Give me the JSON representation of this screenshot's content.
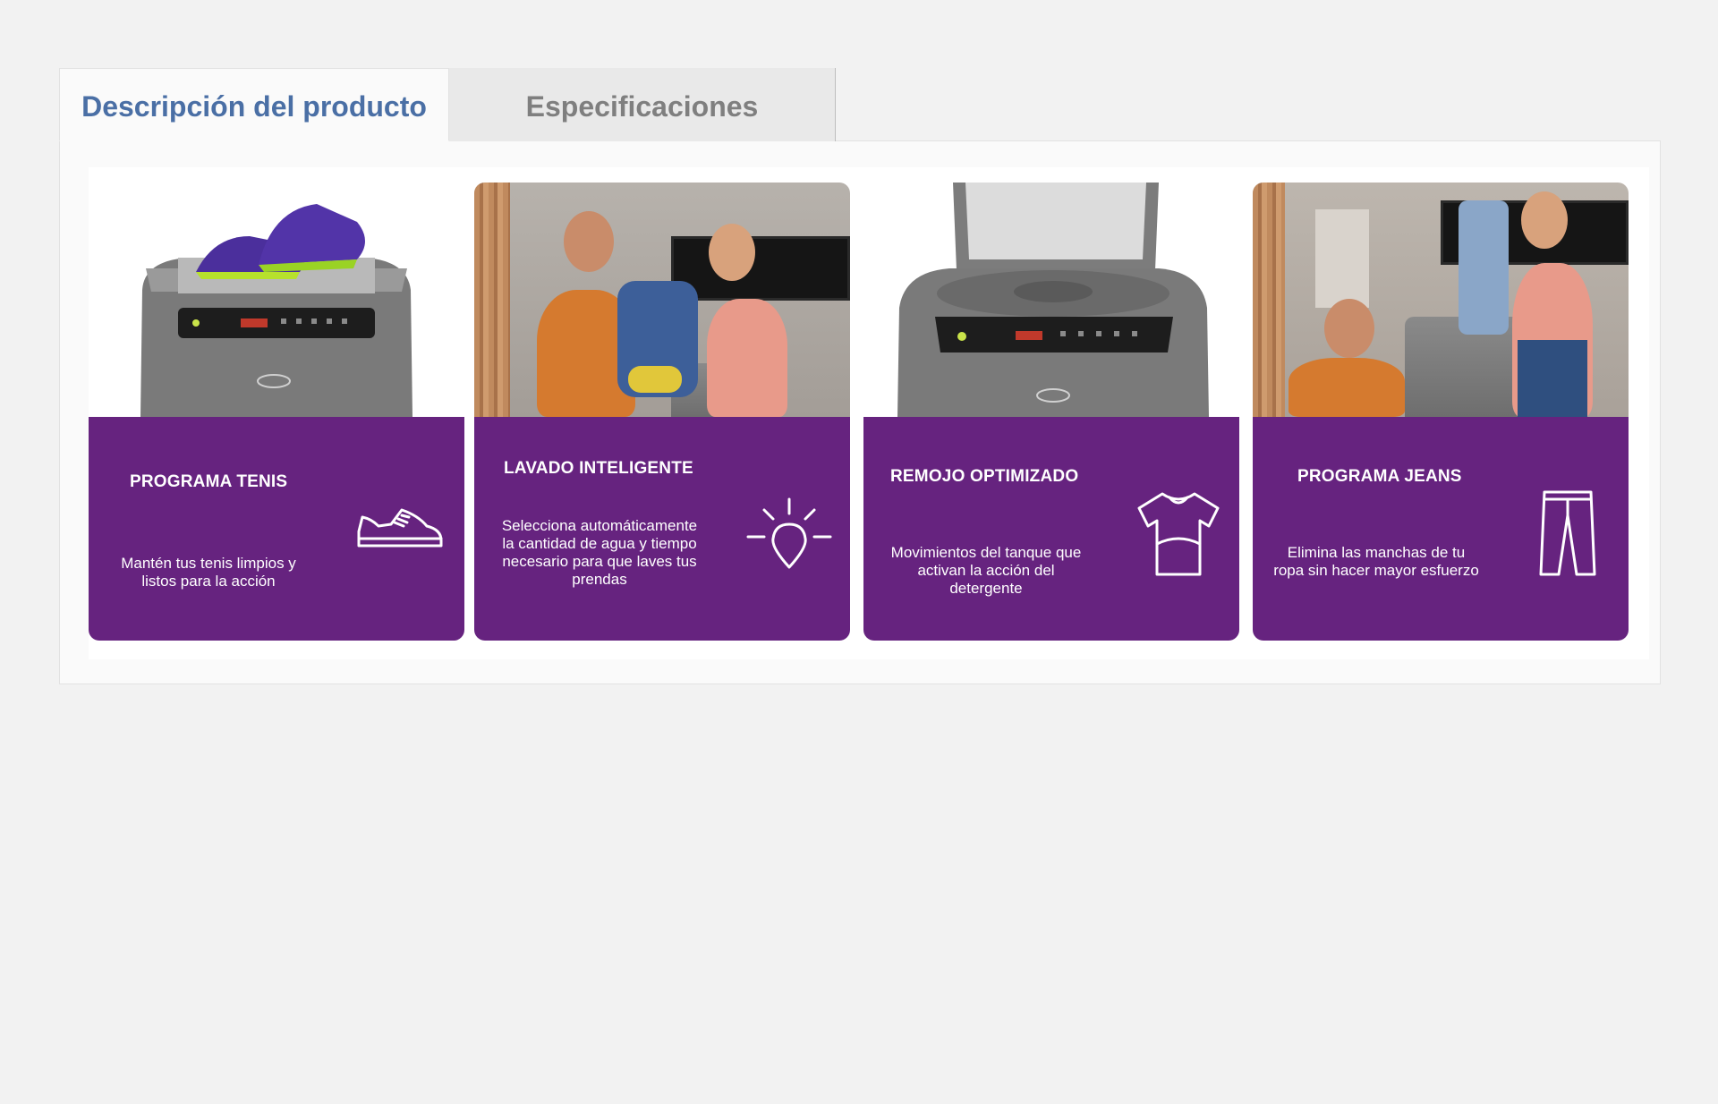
{
  "tabs": [
    {
      "label": "Descripción del producto",
      "active": true
    },
    {
      "label": "Especificaciones",
      "active": false
    }
  ],
  "colors": {
    "active_tab_text": "#4a6fa5",
    "inactive_tab_text": "#7f7f7f",
    "card_purple": "#66237f",
    "page_bg": "#f2f2f2"
  },
  "features": [
    {
      "title": "PROGRAMA TENIS",
      "text": "Mantén tus tenis limpios y listos para la acción",
      "icon": "sneaker-icon",
      "photo": "washer-with-sneakers-photo"
    },
    {
      "title": "LAVADO INTELIGENTE",
      "text": "Selecciona automáticamente la cantidad de agua y tiempo necesario para que laves tus prendas",
      "icon": "lightbulb-drop-icon",
      "photo": "couple-with-laundry-photo"
    },
    {
      "title": "REMOJO OPTIMIZADO",
      "text": "Movimientos del tanque que activan la acción del detergente",
      "icon": "tshirt-icon",
      "photo": "open-washer-photo"
    },
    {
      "title": "PROGRAMA JEANS",
      "text": "Elimina las manchas de tu ropa sin hacer mayor esfuerzo",
      "icon": "jeans-icon",
      "photo": "couple-with-jeans-photo"
    }
  ]
}
